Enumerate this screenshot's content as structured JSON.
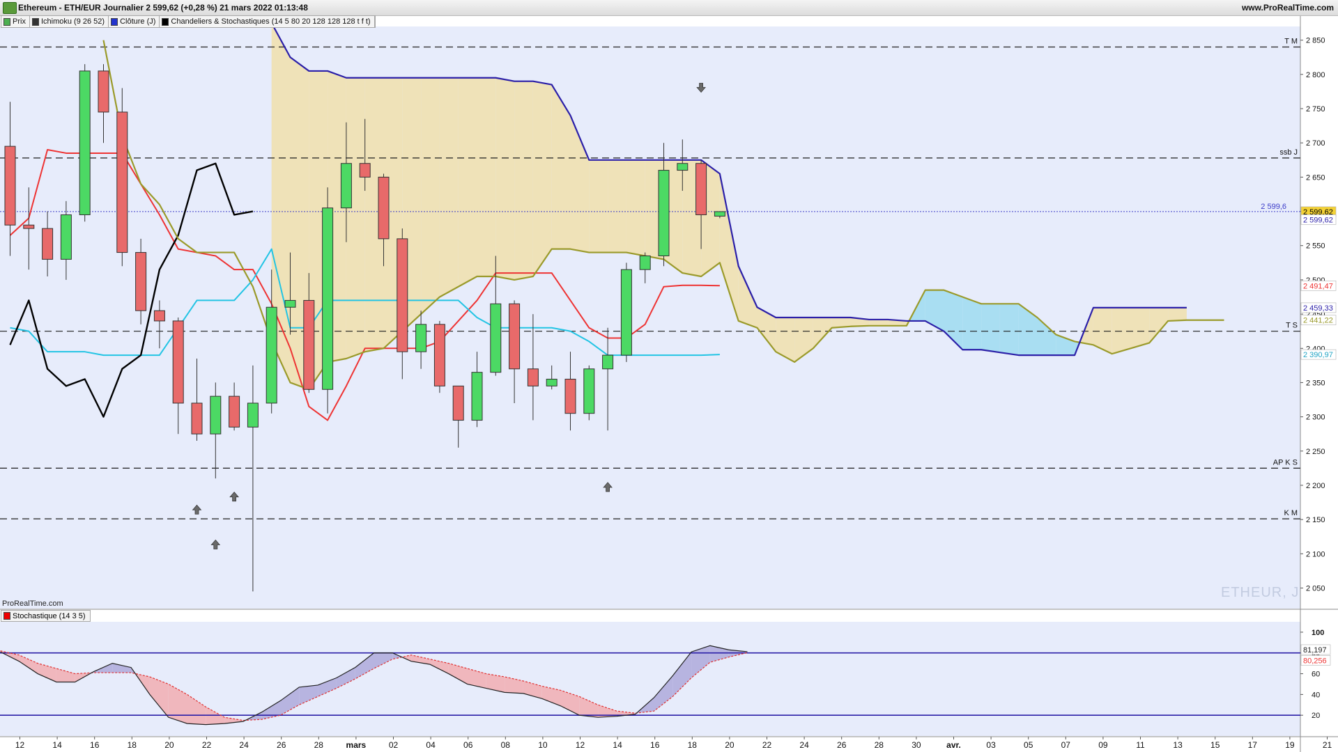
{
  "window": {
    "title": "Ethereum - ETH/EUR Journalier 2 599,62 (+0,28 %) 21 mars 2022 01:13:48",
    "site": "www.ProRealTime.com"
  },
  "legend": [
    {
      "label": "Prix",
      "color": "#4caf50"
    },
    {
      "label": "Ichimoku (9 26 52)",
      "color": "#333333"
    },
    {
      "label": "Clôture (J)",
      "color": "#2233cc"
    },
    {
      "label": "Chandeliers & Stochastiques (14 5 80 20 128 128 128 t f t)",
      "color": "#000000"
    }
  ],
  "brand_label": "ProRealTime.com",
  "watermark": "ETHEUR, J",
  "stoch_panel_label": "Stochastique (14 3 5)",
  "colors": {
    "background": "#e7ecfb",
    "bull": "#4cd964",
    "bear": "#e86a6a",
    "tenkan": "#ee3333",
    "kijun": "#22c4e4",
    "chikou": "#000000",
    "ssa": "#9a9a2a",
    "ssb": "#2b1fa8",
    "kumo_bull": "#efe2b8",
    "kumo_bear": "#a9def2"
  },
  "chart_data": [
    {
      "type": "candlestick",
      "ylim": [
        2020,
        2870
      ],
      "yticks": [
        2050,
        2100,
        2150,
        2200,
        2250,
        2300,
        2350,
        2400,
        2450,
        2500,
        2550,
        2600,
        2650,
        2700,
        2750,
        2800,
        2850
      ],
      "ytick_labels": [
        "2 050",
        "2 100",
        "2 150",
        "2 200",
        "2 250",
        "2 300",
        "2 350",
        "2 400",
        "2 450",
        "2 500",
        "2 550",
        "2 600",
        "2 650",
        "2 700",
        "2 750",
        "2 800",
        "2 850"
      ],
      "x_tick_labels": [
        "12",
        "14",
        "16",
        "18",
        "20",
        "22",
        "24",
        "26",
        "28",
        "mars",
        "02",
        "04",
        "06",
        "08",
        "10",
        "12",
        "14",
        "16",
        "18",
        "20",
        "22",
        "24",
        "26",
        "28",
        "30",
        "avr.",
        "03",
        "05",
        "07",
        "09",
        "11",
        "13",
        "15",
        "17",
        "19",
        "21"
      ],
      "candles": [
        {
          "o": 2695,
          "h": 2760,
          "l": 2535,
          "c": 2580
        },
        {
          "o": 2580,
          "h": 2635,
          "l": 2515,
          "c": 2575
        },
        {
          "o": 2575,
          "h": 2600,
          "l": 2505,
          "c": 2530
        },
        {
          "o": 2530,
          "h": 2615,
          "l": 2500,
          "c": 2595
        },
        {
          "o": 2595,
          "h": 2815,
          "l": 2585,
          "c": 2805
        },
        {
          "o": 2805,
          "h": 2815,
          "l": 2700,
          "c": 2745
        },
        {
          "o": 2745,
          "h": 2780,
          "l": 2520,
          "c": 2540
        },
        {
          "o": 2540,
          "h": 2560,
          "l": 2435,
          "c": 2455
        },
        {
          "o": 2455,
          "h": 2470,
          "l": 2400,
          "c": 2440
        },
        {
          "o": 2440,
          "h": 2445,
          "l": 2275,
          "c": 2320
        },
        {
          "o": 2320,
          "h": 2385,
          "l": 2265,
          "c": 2275
        },
        {
          "o": 2275,
          "h": 2350,
          "l": 2210,
          "c": 2330
        },
        {
          "o": 2330,
          "h": 2350,
          "l": 2280,
          "c": 2285
        },
        {
          "o": 2285,
          "h": 2375,
          "l": 2045,
          "c": 2320
        },
        {
          "o": 2320,
          "h": 2515,
          "l": 2305,
          "c": 2460
        },
        {
          "o": 2460,
          "h": 2540,
          "l": 2420,
          "c": 2470
        },
        {
          "o": 2470,
          "h": 2510,
          "l": 2335,
          "c": 2340
        },
        {
          "o": 2340,
          "h": 2635,
          "l": 2305,
          "c": 2605
        },
        {
          "o": 2605,
          "h": 2730,
          "l": 2555,
          "c": 2670
        },
        {
          "o": 2670,
          "h": 2735,
          "l": 2630,
          "c": 2650
        },
        {
          "o": 2650,
          "h": 2655,
          "l": 2520,
          "c": 2560
        },
        {
          "o": 2560,
          "h": 2575,
          "l": 2355,
          "c": 2395
        },
        {
          "o": 2395,
          "h": 2455,
          "l": 2370,
          "c": 2435
        },
        {
          "o": 2435,
          "h": 2440,
          "l": 2335,
          "c": 2345
        },
        {
          "o": 2345,
          "h": 2345,
          "l": 2255,
          "c": 2295
        },
        {
          "o": 2295,
          "h": 2395,
          "l": 2285,
          "c": 2365
        },
        {
          "o": 2365,
          "h": 2535,
          "l": 2360,
          "c": 2465
        },
        {
          "o": 2465,
          "h": 2470,
          "l": 2320,
          "c": 2370
        },
        {
          "o": 2370,
          "h": 2450,
          "l": 2295,
          "c": 2345
        },
        {
          "o": 2345,
          "h": 2375,
          "l": 2340,
          "c": 2355
        },
        {
          "o": 2355,
          "h": 2395,
          "l": 2280,
          "c": 2305
        },
        {
          "o": 2305,
          "h": 2375,
          "l": 2295,
          "c": 2370
        },
        {
          "o": 2370,
          "h": 2430,
          "l": 2280,
          "c": 2390
        },
        {
          "o": 2390,
          "h": 2525,
          "l": 2380,
          "c": 2515
        },
        {
          "o": 2515,
          "h": 2540,
          "l": 2495,
          "c": 2535
        },
        {
          "o": 2535,
          "h": 2700,
          "l": 2520,
          "c": 2660
        },
        {
          "o": 2660,
          "h": 2705,
          "l": 2630,
          "c": 2670
        },
        {
          "o": 2670,
          "h": 2675,
          "l": 2545,
          "c": 2595
        },
        {
          "o": 2593,
          "h": 2600,
          "l": 2590,
          "c": 2599.62
        }
      ],
      "series": [
        {
          "name": "Tenkan",
          "start": 0,
          "values": [
            2565,
            2590,
            2690,
            2685,
            2685,
            2685,
            2685,
            2640,
            2595,
            2545,
            2540,
            2535,
            2515,
            2515,
            2465,
            2400,
            2315,
            2295,
            2345,
            2400,
            2400,
            2400,
            2400,
            2410,
            2440,
            2470,
            2510,
            2510,
            2510,
            2510,
            2470,
            2430,
            2415,
            2415,
            2435,
            2490,
            2492,
            2492,
            2491.47
          ]
        },
        {
          "name": "Kijun",
          "start": 0,
          "values": [
            2430,
            2425,
            2395,
            2395,
            2395,
            2390,
            2390,
            2390,
            2390,
            2430,
            2470,
            2470,
            2470,
            2500,
            2545,
            2430,
            2430,
            2470,
            2470,
            2470,
            2470,
            2470,
            2470,
            2470,
            2470,
            2445,
            2430,
            2430,
            2430,
            2430,
            2425,
            2410,
            2390,
            2390,
            2390,
            2390,
            2390,
            2390,
            2390.97
          ]
        },
        {
          "name": "Chikou",
          "start": 0,
          "values": [
            2405,
            2470,
            2370,
            2345,
            2355,
            2300,
            2370,
            2390,
            2515,
            2565,
            2660,
            2670,
            2595,
            2600
          ]
        },
        {
          "name": "SSA",
          "start": 5,
          "values": [
            2850,
            2710,
            2640,
            2610,
            2560,
            2540,
            2540,
            2540,
            2490,
            2410,
            2350,
            2340,
            2380,
            2385,
            2395,
            2400,
            2425,
            2450,
            2475,
            2490,
            2505,
            2505,
            2500,
            2505,
            2545,
            2545,
            2540,
            2540,
            2540,
            2535,
            2530,
            2510,
            2505,
            2525,
            2440,
            2430,
            2395,
            2380,
            2400,
            2430,
            2432,
            2433,
            2433,
            2433,
            2485,
            2485,
            2475,
            2465,
            2465,
            2465,
            2445,
            2420,
            2410,
            2405,
            2392,
            2400,
            2408,
            2440,
            2441.22,
            2441.22,
            2441.22
          ]
        },
        {
          "name": "SSB",
          "start": 14,
          "values": [
            2875,
            2825,
            2805,
            2805,
            2795,
            2795,
            2795,
            2795,
            2795,
            2795,
            2795,
            2795,
            2795,
            2790,
            2790,
            2785,
            2740,
            2675,
            2675,
            2675,
            2675,
            2675,
            2675,
            2675,
            2655,
            2520,
            2460,
            2445,
            2445,
            2445,
            2445,
            2445,
            2442,
            2442,
            2440,
            2440,
            2425,
            2398,
            2398,
            2394,
            2390,
            2390,
            2390,
            2390,
            2459.33,
            2459.33,
            2459.33,
            2459.33,
            2459.33,
            2459.33
          ]
        }
      ],
      "levels": [
        {
          "label": "T M",
          "value": 2840
        },
        {
          "label": "ssb J",
          "value": 2678
        },
        {
          "label": "T S",
          "value": 2425
        },
        {
          "label": "AP K S",
          "value": 2225
        },
        {
          "label": "K M",
          "value": 2151
        }
      ],
      "current_price": {
        "value": 2599.62,
        "annotation": "2 599,6"
      },
      "price_tags": [
        {
          "value": 2599.62,
          "label": "2 599,62",
          "bg": "#f4d236",
          "fg": "#000000"
        },
        {
          "value": 2588,
          "label": "2 599,62",
          "bg": "#ffffff",
          "fg": "#2b1fa8"
        },
        {
          "value": 2491.47,
          "label": "2 491,47",
          "bg": "#ffffff",
          "fg": "#ee3333"
        },
        {
          "value": 2459.33,
          "label": "2 459,33",
          "bg": "#ffffff",
          "fg": "#2b1fa8"
        },
        {
          "value": 2441.22,
          "label": "2 441,22",
          "bg": "#ffffff",
          "fg": "#9a9a2a"
        },
        {
          "value": 2390.97,
          "label": "2 390,97",
          "bg": "#ffffff",
          "fg": "#22a4c4"
        }
      ],
      "signals": [
        {
          "index": 10,
          "direction": "up",
          "value": 2164
        },
        {
          "index": 11,
          "direction": "up",
          "value": 2113
        },
        {
          "index": 12,
          "direction": "up",
          "value": 2183
        },
        {
          "index": 32,
          "direction": "up",
          "value": 2197
        },
        {
          "index": 37,
          "direction": "down",
          "value": 2781
        }
      ]
    },
    {
      "type": "line",
      "name": "Stochastique (14 3 5)",
      "ylim": [
        0,
        110
      ],
      "yticks": [
        20,
        40,
        60,
        80,
        100
      ],
      "ytick_labels": [
        "20",
        "40",
        "60",
        "80",
        "100"
      ],
      "levels": [
        80,
        20
      ],
      "series": [
        {
          "name": "%K",
          "values": [
            81,
            72,
            60,
            52,
            52,
            62,
            70,
            66,
            40,
            18,
            12,
            11,
            12,
            14,
            23,
            34,
            47,
            49,
            56,
            66,
            80,
            80,
            72,
            69,
            60,
            50,
            46,
            42,
            41,
            36,
            29,
            20,
            18,
            19,
            21,
            37,
            58,
            81,
            87,
            83,
            81.197
          ]
        },
        {
          "name": "%D",
          "values": [
            82,
            78,
            70,
            65,
            60,
            61,
            61,
            61,
            57,
            50,
            40,
            28,
            18,
            15,
            16,
            20,
            30,
            38,
            46,
            55,
            65,
            74,
            78,
            74,
            70,
            65,
            60,
            57,
            53,
            48,
            44,
            38,
            30,
            24,
            22,
            24,
            38,
            56,
            71,
            76,
            80.256
          ]
        }
      ],
      "value_tags": [
        {
          "value": 81.197,
          "label": "81,197",
          "fg": "#222222"
        },
        {
          "value": 80.256,
          "label": "80,256",
          "fg": "#ee3333"
        }
      ]
    }
  ]
}
